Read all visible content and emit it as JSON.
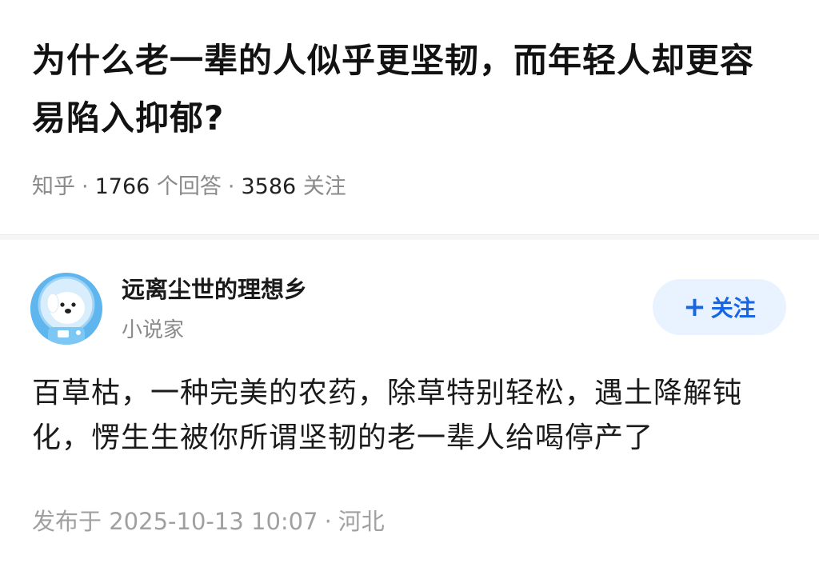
{
  "question": {
    "title": "为什么老一辈的人似乎更坚韧，而年轻人却更容易陷入抑郁?",
    "source": "知乎",
    "separator": "·",
    "answer_count": "1766",
    "answer_count_label": "个回答",
    "follow_count": "3586",
    "follow_count_label": "关注"
  },
  "answer": {
    "author": {
      "name": "远离尘世的理想乡",
      "headline": "小说家",
      "avatar_icon": "astronaut-dog-avatar"
    },
    "follow_button": {
      "icon": "plus-icon",
      "icon_glyph": "+",
      "label": "关注"
    },
    "content": "百草枯，一种完美的农药，除草特别轻松，遇土降解钝化，愣生生被你所谓坚韧的老一辈人给喝停产了",
    "publish_prefix": "发布于",
    "publish_time": "2025-10-13 10:07",
    "separator": "·",
    "location": "河北"
  },
  "colors": {
    "accent": "#1766e6",
    "follow_bg": "#e9f3ff",
    "text_primary": "#121212",
    "text_secondary": "#8a8a8a"
  }
}
